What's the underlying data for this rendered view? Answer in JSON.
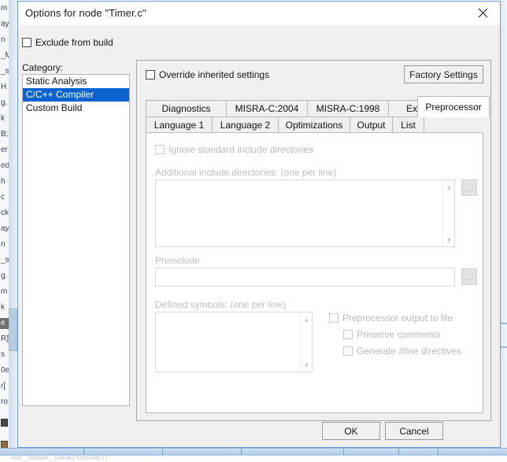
{
  "background": {
    "code_fragments": [
      "m",
      "ay",
      "n",
      "_M",
      "_s",
      "H",
      "g.",
      "k",
      "B;",
      "er",
      "ed",
      "h",
      "c",
      "ck",
      "ay",
      "n",
      "_s",
      "g.",
      "m",
      "k",
      "e",
      "R]",
      "s",
      "0e",
      "r[",
      "ro"
    ],
    "highlight_index": 20,
    "bottom_text": "void __attribute__((weak)) func(void) { }"
  },
  "dialog": {
    "title": "Options for node \"Timer.c\"",
    "close_icon": "close-icon",
    "exclude_from_build": {
      "label": "Exclude from build",
      "checked": false
    },
    "category": {
      "label": "Category:",
      "items": [
        {
          "label": "Static Analysis",
          "selected": false
        },
        {
          "label": "C/C++ Compiler",
          "selected": true
        },
        {
          "label": "Custom Build",
          "selected": false
        }
      ],
      "selection_color": "#0a63ce"
    },
    "override": {
      "label": "Override inherited settings",
      "checked": false
    },
    "factory_settings_label": "Factory Settings",
    "tabs": {
      "row1": [
        "Diagnostics",
        "MISRA-C:2004",
        "MISRA-C:1998",
        "Extra Options"
      ],
      "row2": [
        "Language 1",
        "Language 2",
        "Optimizations",
        "Output",
        "List"
      ],
      "active": "Preprocessor"
    },
    "preprocessor": {
      "ignore_standard_includes": {
        "label": "Ignore standard include directories",
        "accel": "I",
        "checked": false
      },
      "additional_includes": {
        "label": "Additional include directories: (one per line)",
        "accel": "A",
        "value": "",
        "browse_label": "..."
      },
      "preinclude": {
        "label": "Preinclude",
        "accel": "r",
        "value": "",
        "browse_label": "..."
      },
      "defined_symbols": {
        "label": "Defined symbols: (one per line)",
        "accel": "D",
        "value": ""
      },
      "output_to_file": {
        "label": "Preprocessor output to file",
        "accel": "P",
        "checked": false
      },
      "preserve_comments": {
        "label": "Preserve comments",
        "accel": "c",
        "checked": false
      },
      "generate_line_directives": {
        "label": "Generate #line directives",
        "accel": "G",
        "checked": false
      }
    },
    "ok_label": "OK",
    "cancel_label": "Cancel"
  }
}
